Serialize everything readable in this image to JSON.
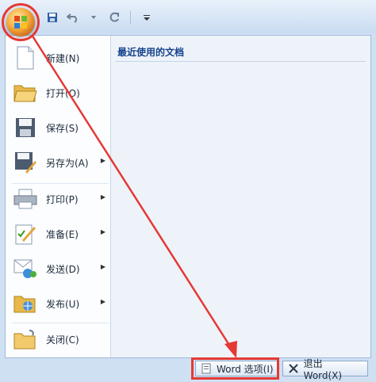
{
  "qat": {
    "save_icon": "save-icon",
    "undo_icon": "undo-icon",
    "redo_icon": "redo-icon",
    "customize_icon": "customize-qat-icon"
  },
  "menu": {
    "items": [
      {
        "label": "新建(N)",
        "icon": "new-document-icon",
        "submenu": false
      },
      {
        "label": "打开(O)",
        "icon": "open-folder-icon",
        "submenu": false
      },
      {
        "label": "保存(S)",
        "icon": "save-icon",
        "submenu": false
      },
      {
        "label": "另存为(A)",
        "icon": "save-as-icon",
        "submenu": true
      },
      {
        "label": "打印(P)",
        "icon": "printer-icon",
        "submenu": true
      },
      {
        "label": "准备(E)",
        "icon": "prepare-icon",
        "submenu": true
      },
      {
        "label": "发送(D)",
        "icon": "send-icon",
        "submenu": true
      },
      {
        "label": "发布(U)",
        "icon": "publish-icon",
        "submenu": true
      },
      {
        "label": "关闭(C)",
        "icon": "close-folder-icon",
        "submenu": false
      }
    ],
    "recent_title": "最近使用的文档"
  },
  "footer": {
    "options_label": "Word 选项(I)",
    "exit_label": "退出 Word(X)"
  },
  "colors": {
    "highlight": "#e53935",
    "title_text": "#15428b"
  }
}
